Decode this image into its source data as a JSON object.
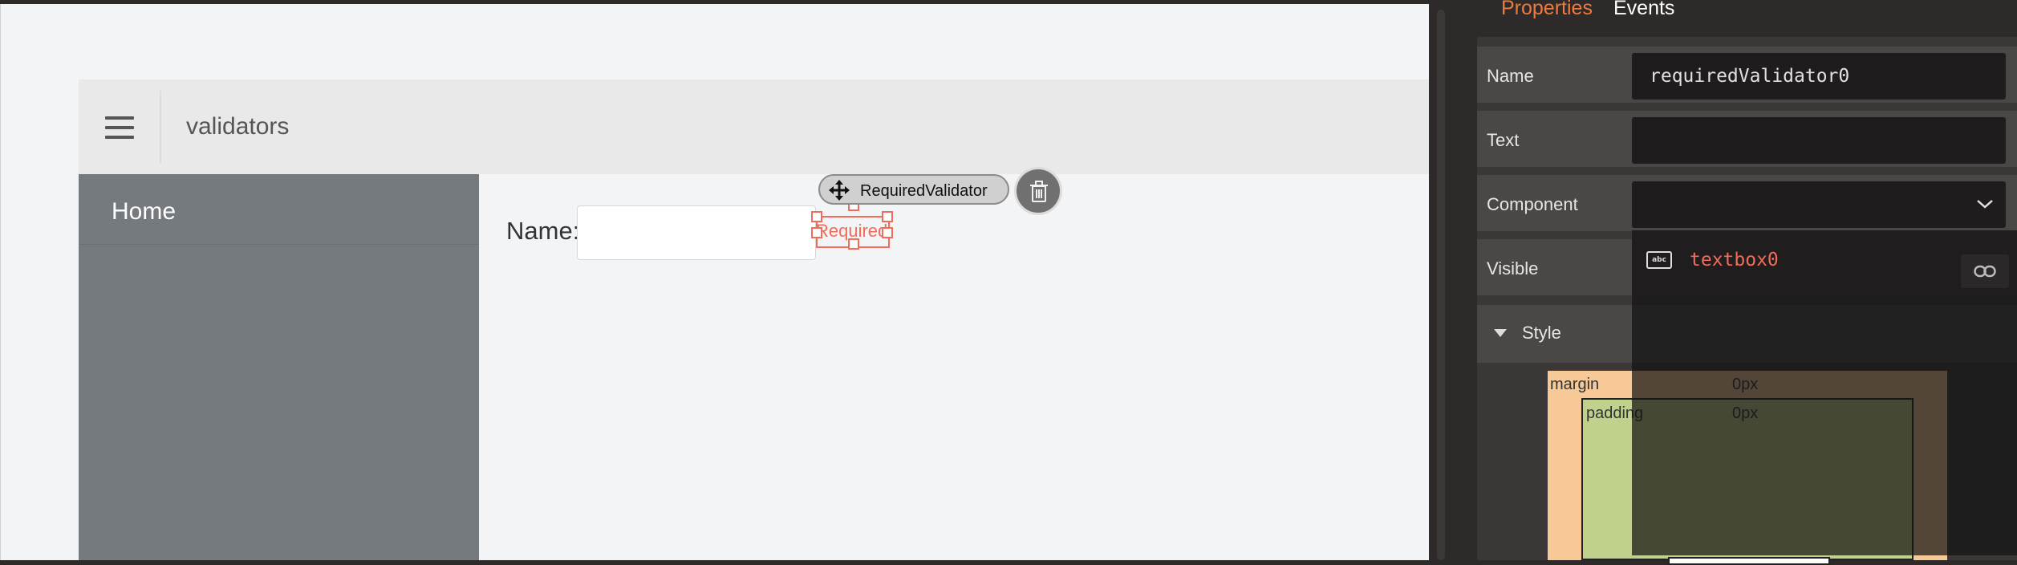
{
  "app": {
    "title": "validators",
    "nav_items": [
      {
        "label": "Home"
      }
    ]
  },
  "form": {
    "name_label": "Name:",
    "name_value": "",
    "validator_text": "Required"
  },
  "selection": {
    "component_type": "RequiredValidator"
  },
  "panel": {
    "tabs": [
      {
        "label": "Properties",
        "active": true
      },
      {
        "label": "Events",
        "active": false
      }
    ],
    "properties": {
      "name_label": "Name",
      "name_value": "requiredValidator0",
      "text_label": "Text",
      "text_value": "",
      "component_label": "Component",
      "component_value": "",
      "visible_label": "Visible",
      "style_label": "Style"
    },
    "component_options": [
      {
        "label": "textbox0",
        "icon": "textbox-icon"
      }
    ],
    "box_model": {
      "margin_label": "margin",
      "margin_value": "0px",
      "padding_label": "padding",
      "padding_value": "0px"
    }
  },
  "colors": {
    "accent": "#ef7a3d",
    "validator_red": "#f26b5b",
    "sidebar": "#757a7e",
    "panel_bg": "#3a3736"
  },
  "icons": {
    "menu": "hamburger-icon",
    "move": "move-icon",
    "delete": "trash-icon",
    "dropdown": "chevron-down-icon",
    "link": "link-icon"
  }
}
